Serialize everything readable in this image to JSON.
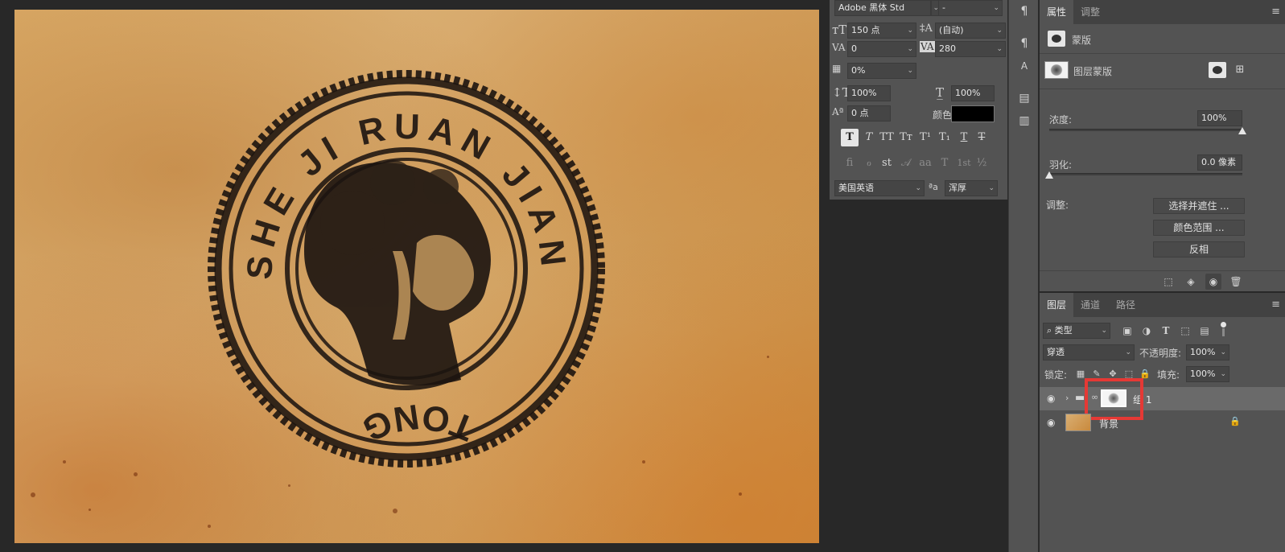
{
  "canvas": {
    "stamp": {
      "text_top": "SHE JI RUAN JIAN",
      "text_bottom": "TONG"
    }
  },
  "character": {
    "font_family": "Adobe 黑体 Std",
    "font_style": "-",
    "size": "150 点",
    "leading": "(自动)",
    "kerning": "0",
    "tracking": "280",
    "tsume": "0%",
    "vscale": "100%",
    "hscale": "100%",
    "baseline": "0 点",
    "color_label": "颜色:",
    "language": "美国英语",
    "aa_label": "ªa",
    "antialias": "浑厚",
    "style_buttons": [
      "T",
      "T",
      "TT",
      "Tт",
      "T¹",
      "T₁",
      "T",
      "T"
    ],
    "opentype_buttons": [
      "fi",
      "ℴ",
      "st",
      "𝒜",
      "aa",
      "T",
      "1st",
      "½"
    ]
  },
  "properties": {
    "tabs": [
      "属性",
      "调整"
    ],
    "mask_title": "蒙版",
    "layer_mask_label": "图层蒙版",
    "density_label": "浓度:",
    "density_value": "100%",
    "density_fraction": 1.0,
    "feather_label": "羽化:",
    "feather_value": "0.0 像素",
    "feather_fraction": 0.0,
    "adjust_label": "调整:",
    "btn_select_mask": "选择并遮住 ...",
    "btn_color_range": "颜色范围 ...",
    "btn_invert": "反相"
  },
  "layers_panel": {
    "tabs": [
      "图层",
      "通道",
      "路径"
    ],
    "filter_kind": "类型",
    "blend_mode": "穿透",
    "opacity_label": "不透明度:",
    "opacity_value": "100%",
    "lock_label": "锁定:",
    "fill_label": "填充:",
    "fill_value": "100%",
    "layers": [
      {
        "name": "组 1",
        "type": "group"
      },
      {
        "name": "背景",
        "type": "background"
      }
    ]
  },
  "colors": {
    "panel_bg": "#535353",
    "app_bg": "#282828",
    "highlight": "#e53935",
    "text_color_swatch": "#000000"
  }
}
